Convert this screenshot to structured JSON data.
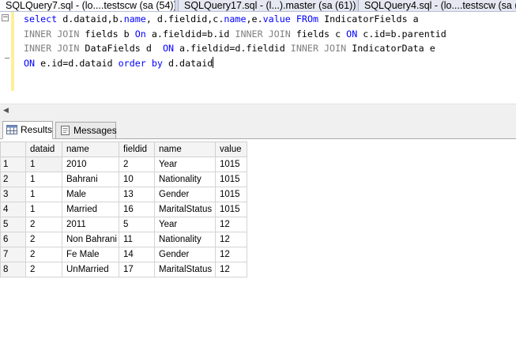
{
  "tabs": [
    {
      "label": "SQLQuery7.sql - (lo....testscw (sa (54))*",
      "active": true
    },
    {
      "label": "SQLQuery17.sql - (l...).master (sa (61))*",
      "active": false
    },
    {
      "label": "SQLQuery4.sql - (lo....testscw (sa (55)",
      "active": false
    }
  ],
  "editor": {
    "lines": [
      [
        {
          "t": "select",
          "k": "kw"
        },
        {
          "t": " d.dataid,b.",
          "k": ""
        },
        {
          "t": "name",
          "k": "kw"
        },
        {
          "t": ", d.fieldid,c.",
          "k": ""
        },
        {
          "t": "name",
          "k": "kw"
        },
        {
          "t": ",e.",
          "k": ""
        },
        {
          "t": "value",
          "k": "kw"
        },
        {
          "t": " ",
          "k": ""
        },
        {
          "t": "FROm",
          "k": "kw"
        },
        {
          "t": " IndicatorFields a",
          "k": ""
        }
      ],
      [
        {
          "t": "INNER JOIN",
          "k": "cont"
        },
        {
          "t": " fields b ",
          "k": ""
        },
        {
          "t": "On",
          "k": "kw"
        },
        {
          "t": " a.fieldid=b.id ",
          "k": ""
        },
        {
          "t": "INNER JOIN",
          "k": "cont"
        },
        {
          "t": " fields c ",
          "k": ""
        },
        {
          "t": "ON",
          "k": "kw"
        },
        {
          "t": " c.id=b.parentid",
          "k": ""
        }
      ],
      [
        {
          "t": "INNER JOIN",
          "k": "cont"
        },
        {
          "t": " DataFields d  ",
          "k": ""
        },
        {
          "t": "ON",
          "k": "kw"
        },
        {
          "t": " a.fieldid=d.fieldid ",
          "k": ""
        },
        {
          "t": "INNER JOIN",
          "k": "cont"
        },
        {
          "t": " IndicatorData e",
          "k": ""
        }
      ],
      [
        {
          "t": "ON",
          "k": "kw"
        },
        {
          "t": " e.id=d.dataid ",
          "k": ""
        },
        {
          "t": "order by",
          "k": "kw"
        },
        {
          "t": " d.dataid",
          "k": ""
        }
      ]
    ]
  },
  "results": {
    "tabs": [
      {
        "label": "Results",
        "active": true,
        "icon": "grid-icon"
      },
      {
        "label": "Messages",
        "active": false,
        "icon": "messages-icon"
      }
    ],
    "columns": [
      "dataid",
      "name",
      "fieldid",
      "name",
      "value"
    ],
    "rows": [
      [
        "1",
        "2010",
        "2",
        "Year",
        "1015"
      ],
      [
        "1",
        "Bahrani",
        "10",
        "Nationality",
        "1015"
      ],
      [
        "1",
        "Male",
        "13",
        "Gender",
        "1015"
      ],
      [
        "1",
        "Married",
        "16",
        "MaritalStatus",
        "1015"
      ],
      [
        "2",
        "2011",
        "5",
        "Year",
        "12"
      ],
      [
        "2",
        "Non Bahrani",
        "11",
        "Nationality",
        "12"
      ],
      [
        "2",
        "Fe Male",
        "14",
        "Gender",
        "12"
      ],
      [
        "2",
        "UnMarried",
        "17",
        "MaritalStatus",
        "12"
      ]
    ],
    "row_numbers": [
      "1",
      "2",
      "3",
      "4",
      "5",
      "6",
      "7",
      "8"
    ]
  }
}
